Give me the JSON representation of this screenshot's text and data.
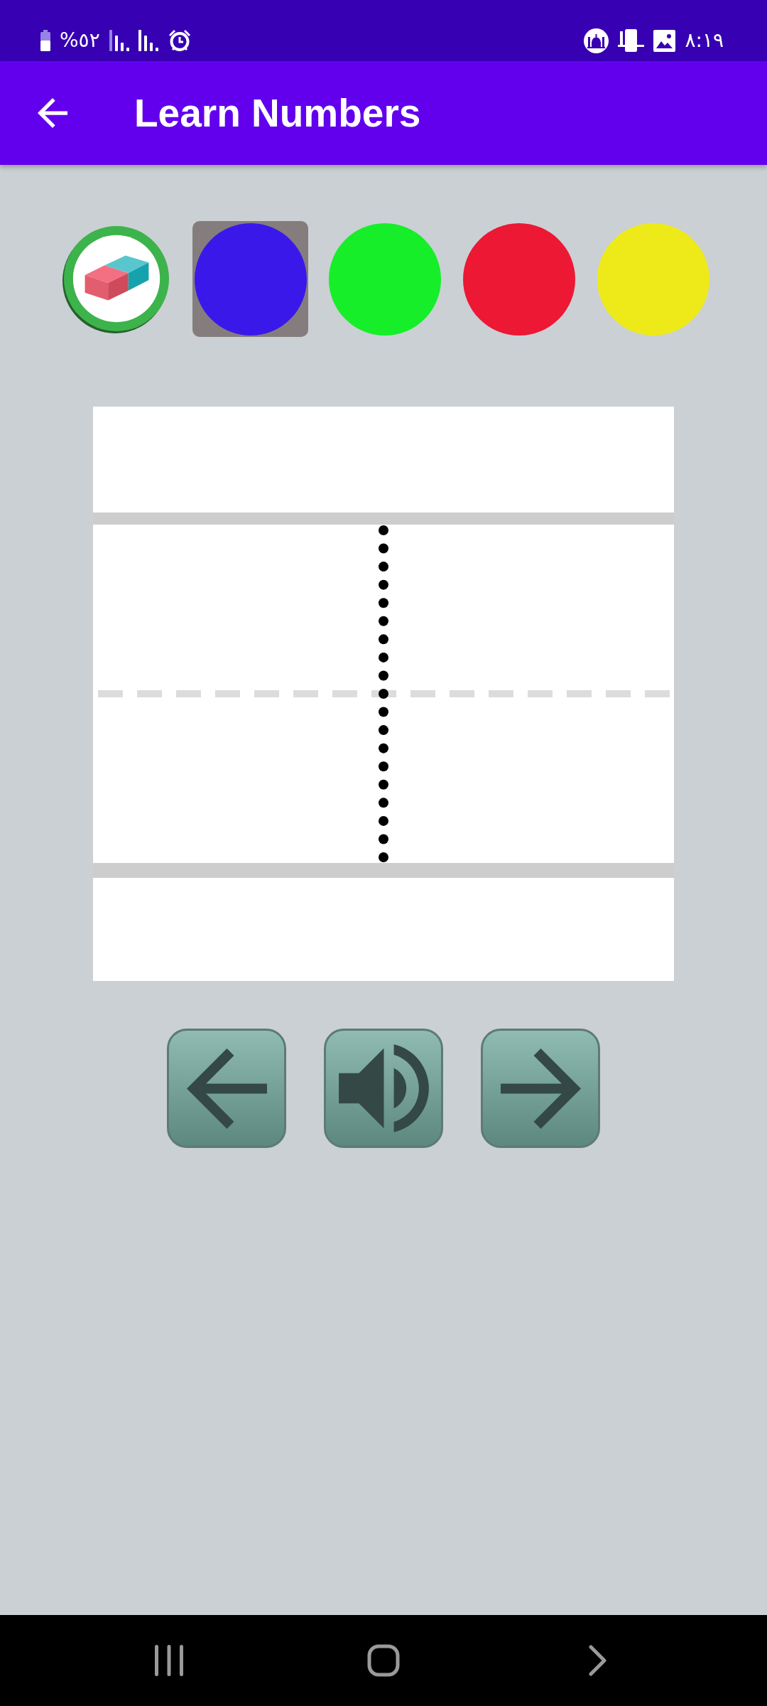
{
  "status_bar": {
    "battery": "%٥٢",
    "time": "٨:١٩"
  },
  "app_bar": {
    "title": "Learn Numbers"
  },
  "palette": [
    {
      "kind": "eraser",
      "selected": false
    },
    {
      "kind": "color",
      "color": "#3a18ea",
      "selected": true
    },
    {
      "kind": "color",
      "color": "#16ee2a",
      "selected": false
    },
    {
      "kind": "color",
      "color": "#ec1834",
      "selected": false
    },
    {
      "kind": "color",
      "color": "#eeea1a",
      "selected": false
    }
  ],
  "controls": [
    {
      "kind": "previous"
    },
    {
      "kind": "sound"
    },
    {
      "kind": "next"
    }
  ]
}
